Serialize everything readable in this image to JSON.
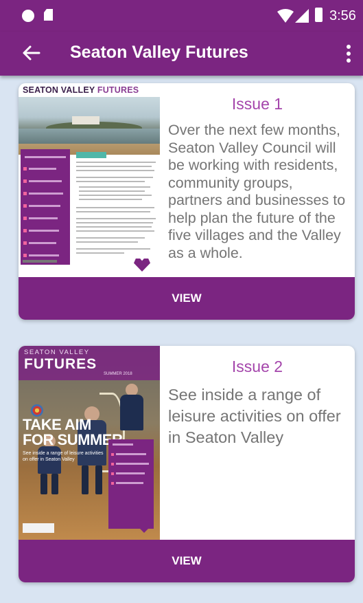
{
  "status_bar": {
    "time": "3:56"
  },
  "app_bar": {
    "title": "Seaton Valley Futures"
  },
  "issues": [
    {
      "title": "Issue 1",
      "description": "Over the next few months, Seaton Valley Council will be working with  residents, community groups, partners and businesses to help plan the  future of the five villages and the Valley as a whole.",
      "view_label": "VIEW",
      "cover": {
        "brand_a": "SEATON VALLEY",
        "brand_b": "FUTURES"
      }
    },
    {
      "title": "Issue 2",
      "description": "See inside a range of leisure activities on offer in Seaton Valley",
      "view_label": "VIEW",
      "cover": {
        "brand_top": "SEATON VALLEY",
        "brand_main": "FUTURES",
        "edition": "SUMMER 2018",
        "headline_1": "TAKE AIM",
        "headline_2": "FOR SUMMER",
        "subline": "See inside a range of leisure activities on offer in Seaton Valley"
      }
    }
  ],
  "colors": {
    "primary": "#7b2581",
    "accent_text": "#a445ab",
    "background": "#d9e4f2"
  }
}
